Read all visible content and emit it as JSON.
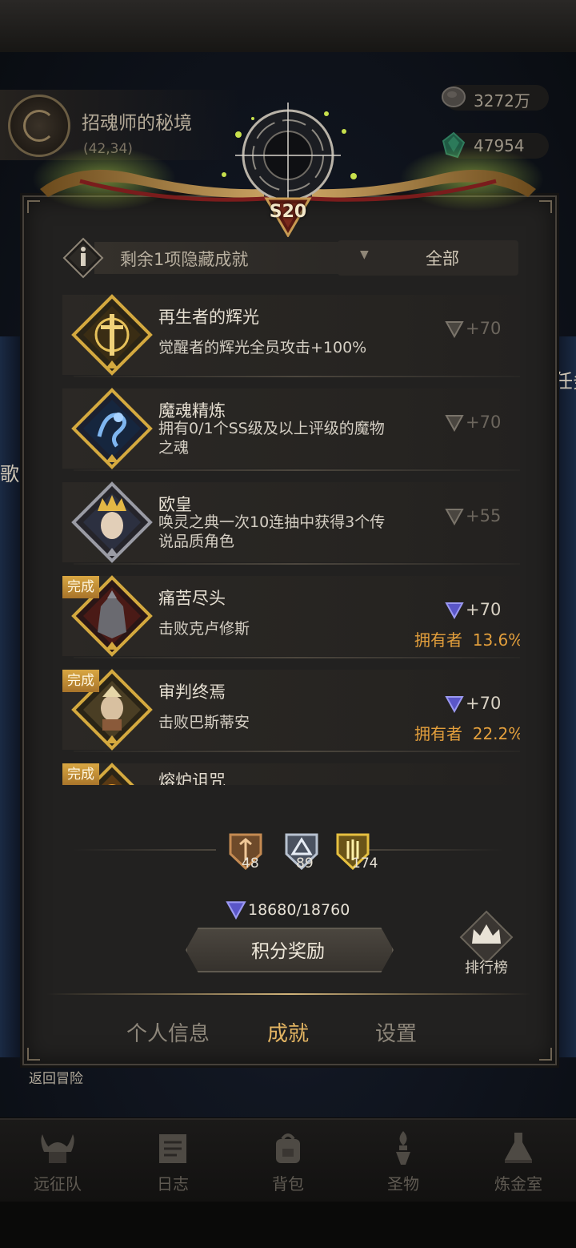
{
  "map": {
    "name": "招魂师的秘境",
    "coords": "(42,34)"
  },
  "resources": [
    {
      "icon": "stone-coin-icon",
      "value": "3272万"
    },
    {
      "icon": "green-crystal-icon",
      "value": "47954"
    }
  ],
  "edge_texts": {
    "left": "歌",
    "right": "任务"
  },
  "season_badge": "S20",
  "filter": {
    "hidden_text": "剩余1项隐藏成就",
    "value": "全部"
  },
  "achievements": [
    {
      "title": "再生者的辉光",
      "desc": "觉醒者的辉光全员攻击+100%",
      "points": "+70",
      "completed": false,
      "icon": "sword-radiance-icon",
      "tier": "gold"
    },
    {
      "title": "魔魂精炼",
      "desc": "拥有0/1个SS级及以上评级的魔物之魂",
      "points": "+70",
      "completed": false,
      "icon": "blue-spirit-icon",
      "tier": "gold"
    },
    {
      "title": "欧皇",
      "desc": "唤灵之典一次10连抽中获得3个传说品质角色",
      "points": "+55",
      "completed": false,
      "icon": "crowned-king-icon",
      "tier": "silver"
    },
    {
      "title": "痛苦尽头",
      "desc": "击败克卢修斯",
      "points": "+70",
      "completed": true,
      "owner_label": "拥有者",
      "owner_value": "13.6%",
      "icon": "dark-knight-icon",
      "tier": "gold"
    },
    {
      "title": "审判终焉",
      "desc": "击败巴斯蒂安",
      "points": "+70",
      "completed": true,
      "owner_label": "拥有者",
      "owner_value": "22.2%",
      "icon": "bastian-priest-icon",
      "tier": "gold"
    },
    {
      "title": "熔炉诅咒",
      "desc": "",
      "points": "",
      "completed": true,
      "icon": "furnace-icon",
      "tier": "gold"
    }
  ],
  "completed_label": "完成",
  "tier_counts": [
    {
      "name": "bronze",
      "count": "48"
    },
    {
      "name": "silver",
      "count": "89"
    },
    {
      "name": "gold",
      "count": "174"
    }
  ],
  "score": "18680/18760",
  "reward_button": "积分奖励",
  "ranking_label": "排行榜",
  "tabs": [
    {
      "label": "个人信息",
      "active": false
    },
    {
      "label": "成就",
      "active": true
    },
    {
      "label": "设置",
      "active": false
    }
  ],
  "back_label": "返回冒险",
  "nav": [
    {
      "label": "远征队",
      "icon": "viking-helmet-icon"
    },
    {
      "label": "日志",
      "icon": "journal-icon"
    },
    {
      "label": "背包",
      "icon": "backpack-icon"
    },
    {
      "label": "圣物",
      "icon": "torch-relic-icon"
    },
    {
      "label": "炼金室",
      "icon": "alchemy-icon"
    }
  ],
  "colors": {
    "accent_gold": "#e2b462",
    "owner_orange": "#e39f3c",
    "done_badge": "#d9a742",
    "points_blue": "#6a6ee8"
  }
}
